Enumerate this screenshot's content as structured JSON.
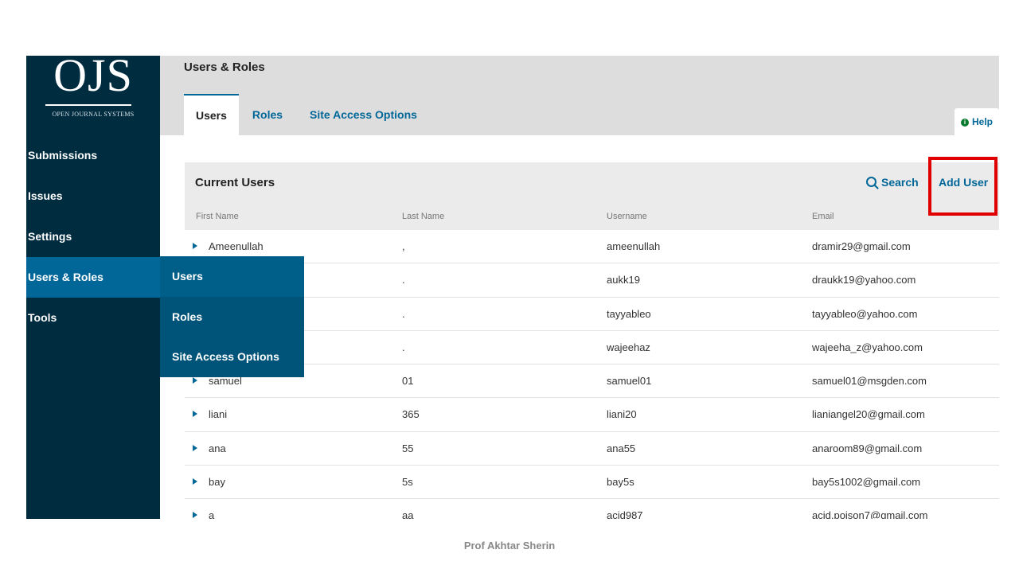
{
  "logo": {
    "text": "OJS",
    "subtitle": "OPEN JOURNAL SYSTEMS"
  },
  "sidebar": {
    "items": [
      {
        "label": "Submissions"
      },
      {
        "label": "Issues"
      },
      {
        "label": "Settings"
      },
      {
        "label": "Users & Roles",
        "active": true
      },
      {
        "label": "Tools"
      }
    ]
  },
  "submenu": {
    "items": [
      {
        "label": "Users"
      },
      {
        "label": "Roles"
      },
      {
        "label": "Site Access Options"
      }
    ]
  },
  "header": {
    "title": "Users & Roles",
    "tabs": [
      {
        "label": "Users",
        "active": true
      },
      {
        "label": "Roles"
      },
      {
        "label": "Site Access Options"
      }
    ],
    "help_label": "Help",
    "help_icon": "info-icon"
  },
  "panel": {
    "title": "Current Users",
    "search_label": "Search",
    "search_icon": "search-icon",
    "add_user_label": "Add User",
    "columns": [
      "First Name",
      "Last Name",
      "Username",
      "Email"
    ],
    "rows": [
      [
        "Ameenullah",
        ",",
        "ameenullah",
        "dramir29@gmail.com"
      ],
      [
        "",
        ".",
        "aukk19",
        "draukk19@yahoo.com"
      ],
      [
        "",
        ".",
        "tayyableo",
        "tayyableo@yahoo.com"
      ],
      [
        "",
        ".",
        "wajeehaz",
        "wajeeha_z@yahoo.com"
      ],
      [
        "samuel",
        "01",
        "samuel01",
        "samuel01@msgden.com"
      ],
      [
        "liani",
        "365",
        "liani20",
        "lianiangel20@gmail.com"
      ],
      [
        "ana",
        "55",
        "ana55",
        "anaroom89@gmail.com"
      ],
      [
        "bay",
        "5s",
        "bay5s",
        "bay5s1002@gmail.com"
      ],
      [
        "a",
        "aa",
        "acid987",
        "acid.poison7@gmail.com"
      ]
    ]
  },
  "footer": {
    "text": "Prof Akhtar Sherin"
  },
  "colors": {
    "sidebar": "#002c40",
    "accent": "#006798",
    "flyout": "#00547a",
    "highlight": "#e00000"
  }
}
